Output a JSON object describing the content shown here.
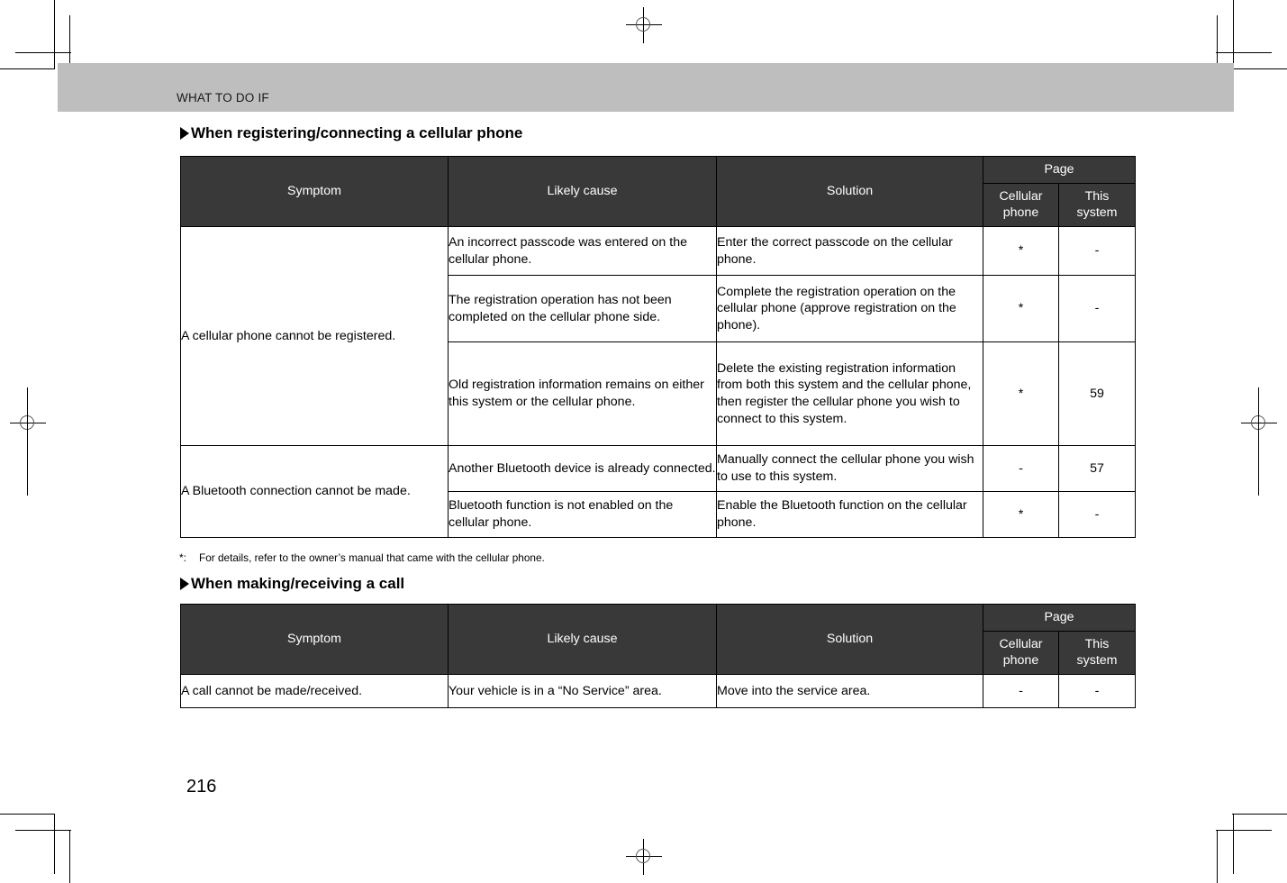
{
  "running_head": "WHAT TO DO IF",
  "folio": "216",
  "sections": [
    {
      "heading": "When registering/connecting a cellular phone",
      "table": {
        "headers": {
          "symptom": "Symptom",
          "likely_cause": "Likely cause",
          "solution": "Solution",
          "page_group": "Page",
          "page_cellular": "Cellular phone",
          "page_this_system": "This system"
        },
        "rows": [
          {
            "symptom": "A cellular phone cannot be registered.",
            "symptom_rowspan": 3,
            "likely_cause": "An incorrect passcode was entered on the cellular phone.",
            "solution": "Enter the correct passcode on the cellular phone.",
            "page_cellular": "*",
            "page_this_system": "-"
          },
          {
            "likely_cause": "The registration operation has not been completed on the cellular phone side.",
            "solution": "Complete the registration operation on the cellular phone (approve registration on the phone).",
            "page_cellular": "*",
            "page_this_system": "-"
          },
          {
            "likely_cause": "Old registration information remains on either this system or the cellular phone.",
            "solution": "Delete the existing registration information from both this system and the cellular phone, then register the cellular phone you wish to connect to this system.",
            "page_cellular": "*",
            "page_this_system": "59"
          },
          {
            "symptom": "A Bluetooth connection cannot be made.",
            "symptom_rowspan": 2,
            "likely_cause": "Another Bluetooth device is already connected.",
            "solution": "Manually connect the cellular phone you wish to use to this system.",
            "page_cellular": "-",
            "page_this_system": "57"
          },
          {
            "likely_cause": "Bluetooth function is not enabled on the cellular phone.",
            "solution": "Enable the Bluetooth function on the cellular phone.",
            "page_cellular": "*",
            "page_this_system": "-"
          }
        ]
      },
      "footnote": {
        "mark": "*:",
        "text": "For details, refer to the owner’s manual that came with the cellular phone."
      }
    },
    {
      "heading": "When making/receiving a call",
      "table": {
        "headers": {
          "symptom": "Symptom",
          "likely_cause": "Likely cause",
          "solution": "Solution",
          "page_group": "Page",
          "page_cellular": "Cellular phone",
          "page_this_system": "This system"
        },
        "rows": [
          {
            "symptom": "A call cannot be made/received.",
            "symptom_rowspan": 1,
            "likely_cause": "Your vehicle is in a “No Service” area.",
            "solution": "Move into the service area.",
            "page_cellular": "-",
            "page_this_system": "-"
          }
        ]
      }
    }
  ],
  "colors": {
    "header_band": "#bebebe",
    "table_header": "#393939",
    "text": "#000000"
  }
}
